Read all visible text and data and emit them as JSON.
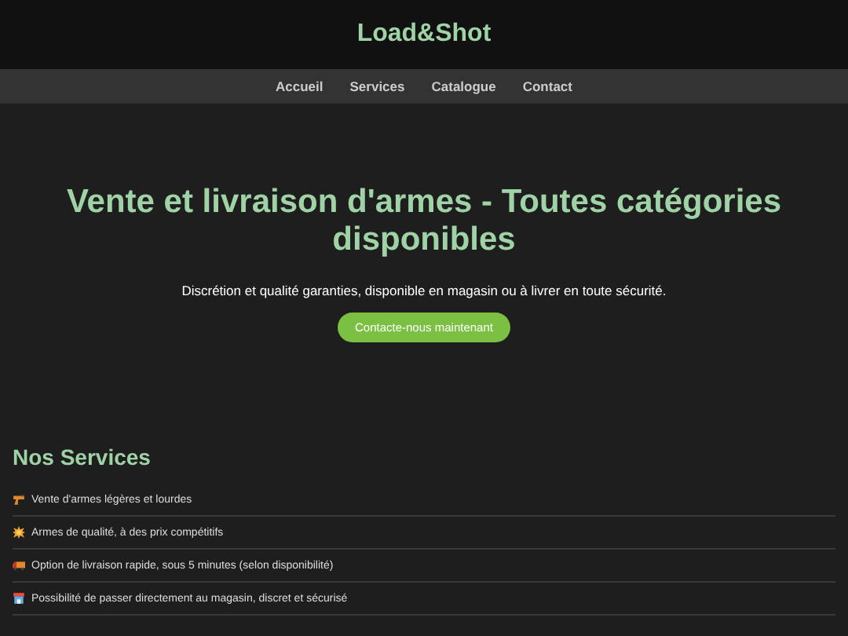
{
  "header": {
    "title": "Load&Shot"
  },
  "nav": [
    {
      "label": "Accueil"
    },
    {
      "label": "Services"
    },
    {
      "label": "Catalogue"
    },
    {
      "label": "Contact"
    }
  ],
  "hero": {
    "title": "Vente et livraison d'armes - Toutes catégories disponibles",
    "subtitle": "Discrétion et qualité garanties, disponible en magasin ou à livrer en toute sécurité.",
    "button": "Contacte-nous maintenant"
  },
  "services": {
    "title": "Nos Services",
    "items": [
      {
        "text": "Vente d'armes légères et lourdes"
      },
      {
        "text": "Armes de qualité, à des prix compétitifs"
      },
      {
        "text": "Option de livraison rapide, sous 5 minutes (selon disponibilité)"
      },
      {
        "text": "Possibilité de passer directement au magasin, discret et sécurisé"
      }
    ]
  }
}
